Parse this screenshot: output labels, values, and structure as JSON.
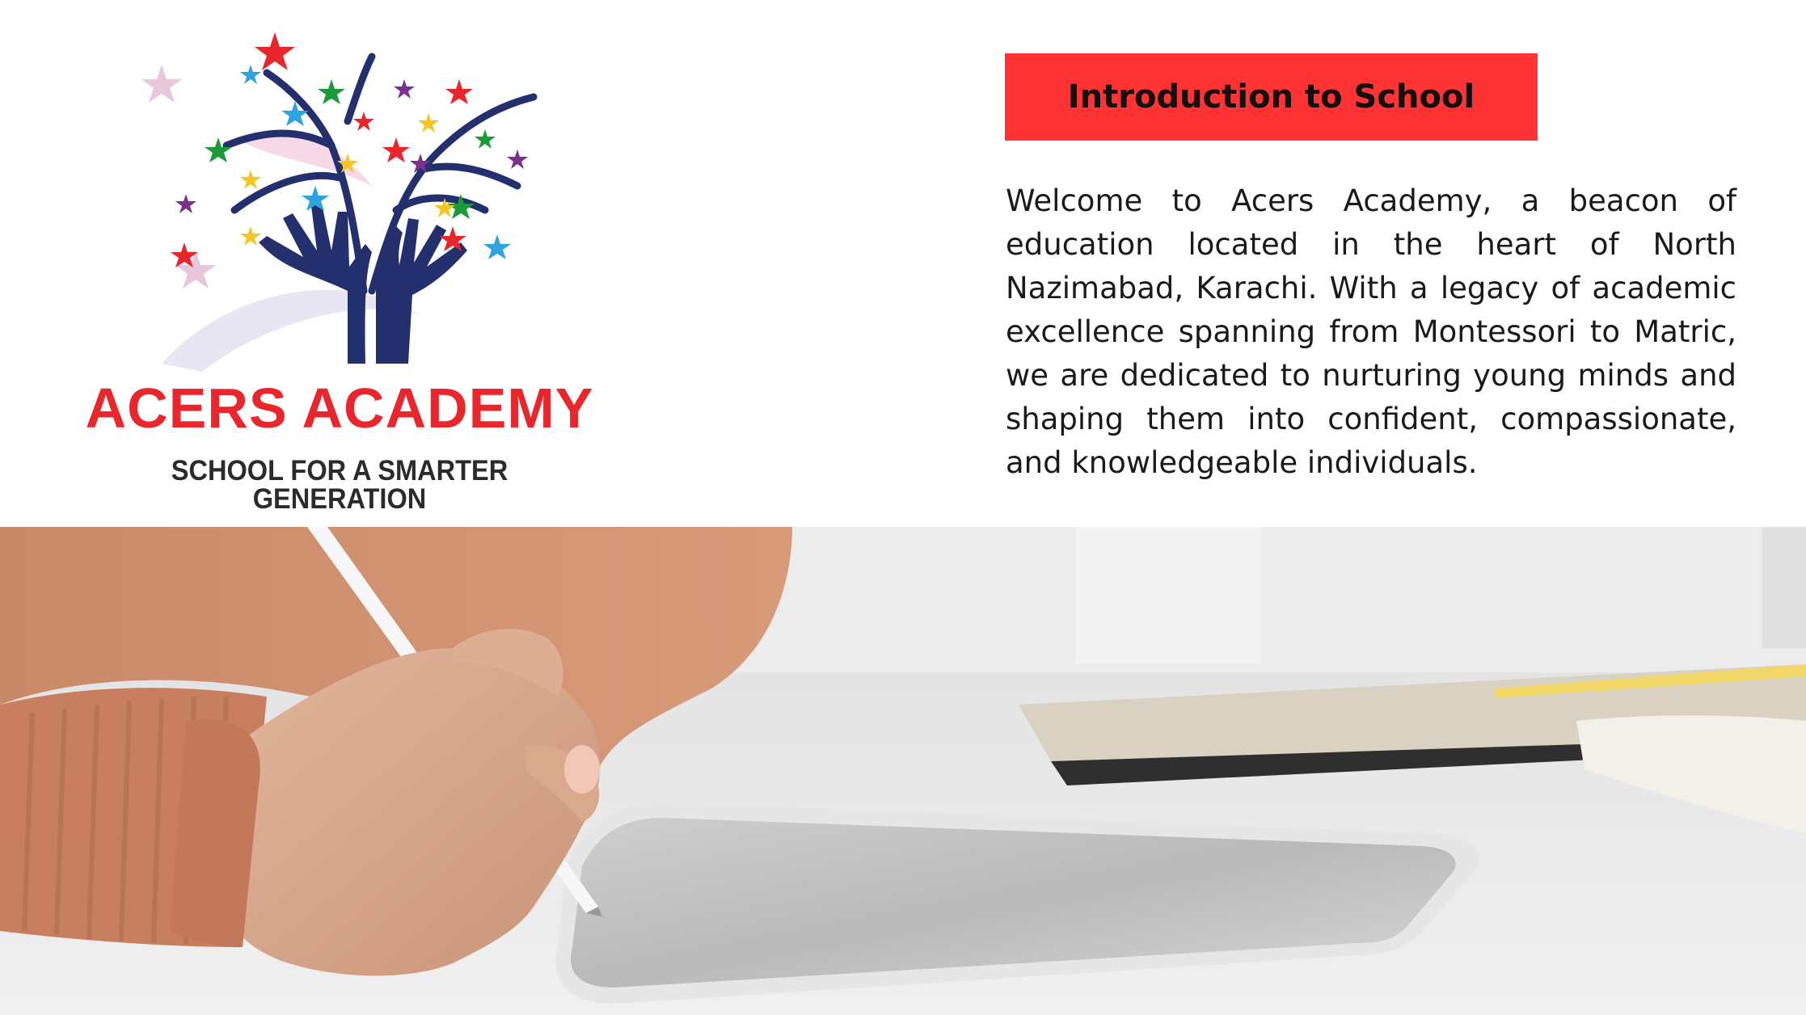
{
  "logo": {
    "name": "ACERS ACADEMY",
    "tagline": "SCHOOL FOR A SMARTER GENERATION"
  },
  "section": {
    "heading": "Introduction to School",
    "body": "Welcome to Acers Academy, a beacon of education located in the heart of North Nazimabad, Karachi. With a legacy of academic excellence spanning from Montessori to Matric, we are dedicated to nurturing young minds and shaping them into confident, compassionate, and knowledgeable individuals."
  },
  "colors": {
    "accent_red": "#ff3333",
    "logo_red": "#e8262b",
    "logo_navy": "#24306e"
  },
  "photo": {
    "icon": "student-writing-on-tablet-photo"
  }
}
